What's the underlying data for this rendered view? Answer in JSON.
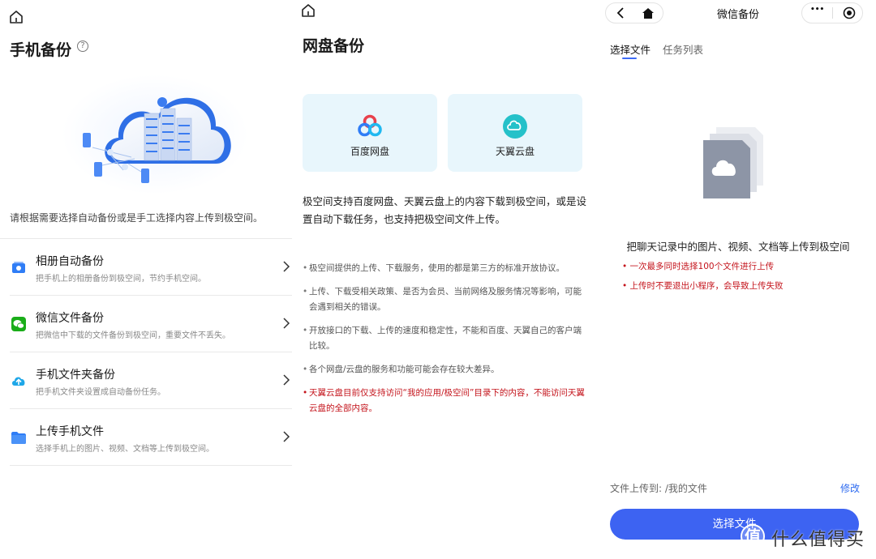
{
  "phone_backup": {
    "title": "手机备份",
    "help_glyph": "?",
    "description": "请根据需要选择自动备份或是手工选择内容上传到极空间。",
    "items": [
      {
        "title": "相册自动备份",
        "subtitle": "把手机上的相册备份到极空间，节约手机空间。",
        "icon": "album-icon",
        "color": "#2f7df6"
      },
      {
        "title": "微信文件备份",
        "subtitle": "把微信中下载的文件备份到极空间，重要文件不丢失。",
        "icon": "wechat-icon",
        "color": "#1aad19"
      },
      {
        "title": "手机文件夹备份",
        "subtitle": "把手机文件夹设置成自动备份任务。",
        "icon": "upload-cloud-icon",
        "color": "#1ea7e8"
      },
      {
        "title": "上传手机文件",
        "subtitle": "选择手机上的图片、视频、文档等上传到极空间。",
        "icon": "folder-icon",
        "color": "#2f7df6"
      }
    ]
  },
  "cloud_backup": {
    "title": "网盘备份",
    "cards": [
      {
        "label": "百度网盘",
        "icon": "baidu-netdisk-icon"
      },
      {
        "label": "天翼云盘",
        "icon": "tianyi-cloud-icon"
      }
    ],
    "description": "极空间支持百度网盘、天翼云盘上的内容下载到极空间，或是设置自动下载任务，也支持把极空间文件上传。",
    "notes": [
      {
        "text": "极空间提供的上传、下载服务，使用的都是第三方的标准开放协议。",
        "red": false
      },
      {
        "text": "上传、下载受相关政策、是否为会员、当前网络及服务情况等影响，可能会遇到相关的错误。",
        "red": false
      },
      {
        "text": "开放接口的下载、上传的速度和稳定性，不能和百度、天翼自己的客户端比较。",
        "red": false
      },
      {
        "text": "各个网盘/云盘的服务和功能可能会存在较大差异。",
        "red": false
      },
      {
        "text": "天翼云盘目前仅支持访问“我的应用/极空间”目录下的内容，不能访问天翼云盘的全部内容。",
        "red": true
      }
    ]
  },
  "wechat_backup": {
    "title": "微信备份",
    "tabs": {
      "active": "选择文件",
      "inactive": "任务列表"
    },
    "main_text": "把聊天记录中的图片、视频、文档等上传到极空间",
    "notes": [
      "一次最多同时选择100个文件进行上传",
      "上传时不要退出小程序，会导致上传失败"
    ],
    "destination": "文件上传到: /我的文件",
    "edit_label": "修改",
    "button_label": "选择文件",
    "more_glyph": "•••"
  },
  "watermark": {
    "circle_glyph": "值",
    "text": "什么值得买"
  },
  "colors": {
    "accent": "#3d63f2",
    "card_bg": "#e8f6fc",
    "warning": "#c4141c",
    "link": "#2f6cf0"
  }
}
